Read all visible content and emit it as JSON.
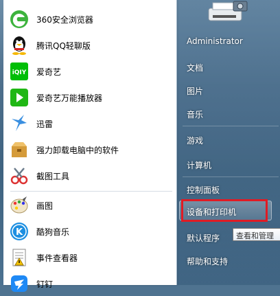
{
  "start_menu": {
    "programs": [
      {
        "label": "360安全浏览器",
        "icon": "360-browser-icon"
      },
      {
        "label": "腾讯QQ轻聊版",
        "icon": "qq-penguin-icon"
      },
      {
        "label": "爱奇艺",
        "icon": "iqiyi-icon"
      },
      {
        "label": "爱奇艺万能播放器",
        "icon": "iqiyi-player-icon"
      },
      {
        "label": "迅雷",
        "icon": "xunlei-icon"
      },
      {
        "label": "强力卸载电脑中的软件",
        "icon": "uninstall-box-icon"
      },
      {
        "label": "截图工具",
        "icon": "snipping-tool-icon"
      },
      {
        "label": "画图",
        "icon": "paint-icon"
      },
      {
        "label": "酷狗音乐",
        "icon": "kugou-icon"
      },
      {
        "label": "事件查看器",
        "icon": "event-viewer-icon"
      },
      {
        "label": "钉钉",
        "icon": "dingtalk-icon"
      }
    ],
    "right_items": {
      "user": "Administrator",
      "documents": "文档",
      "pictures": "图片",
      "music": "音乐",
      "games": "游戏",
      "computer": "计算机",
      "control_panel": "控制面板",
      "devices_printers": "设备和打印机",
      "default_programs": "默认程序",
      "help": "帮助和支持"
    },
    "tooltip": "查看和管理",
    "highlight_color": "#e01b24"
  }
}
